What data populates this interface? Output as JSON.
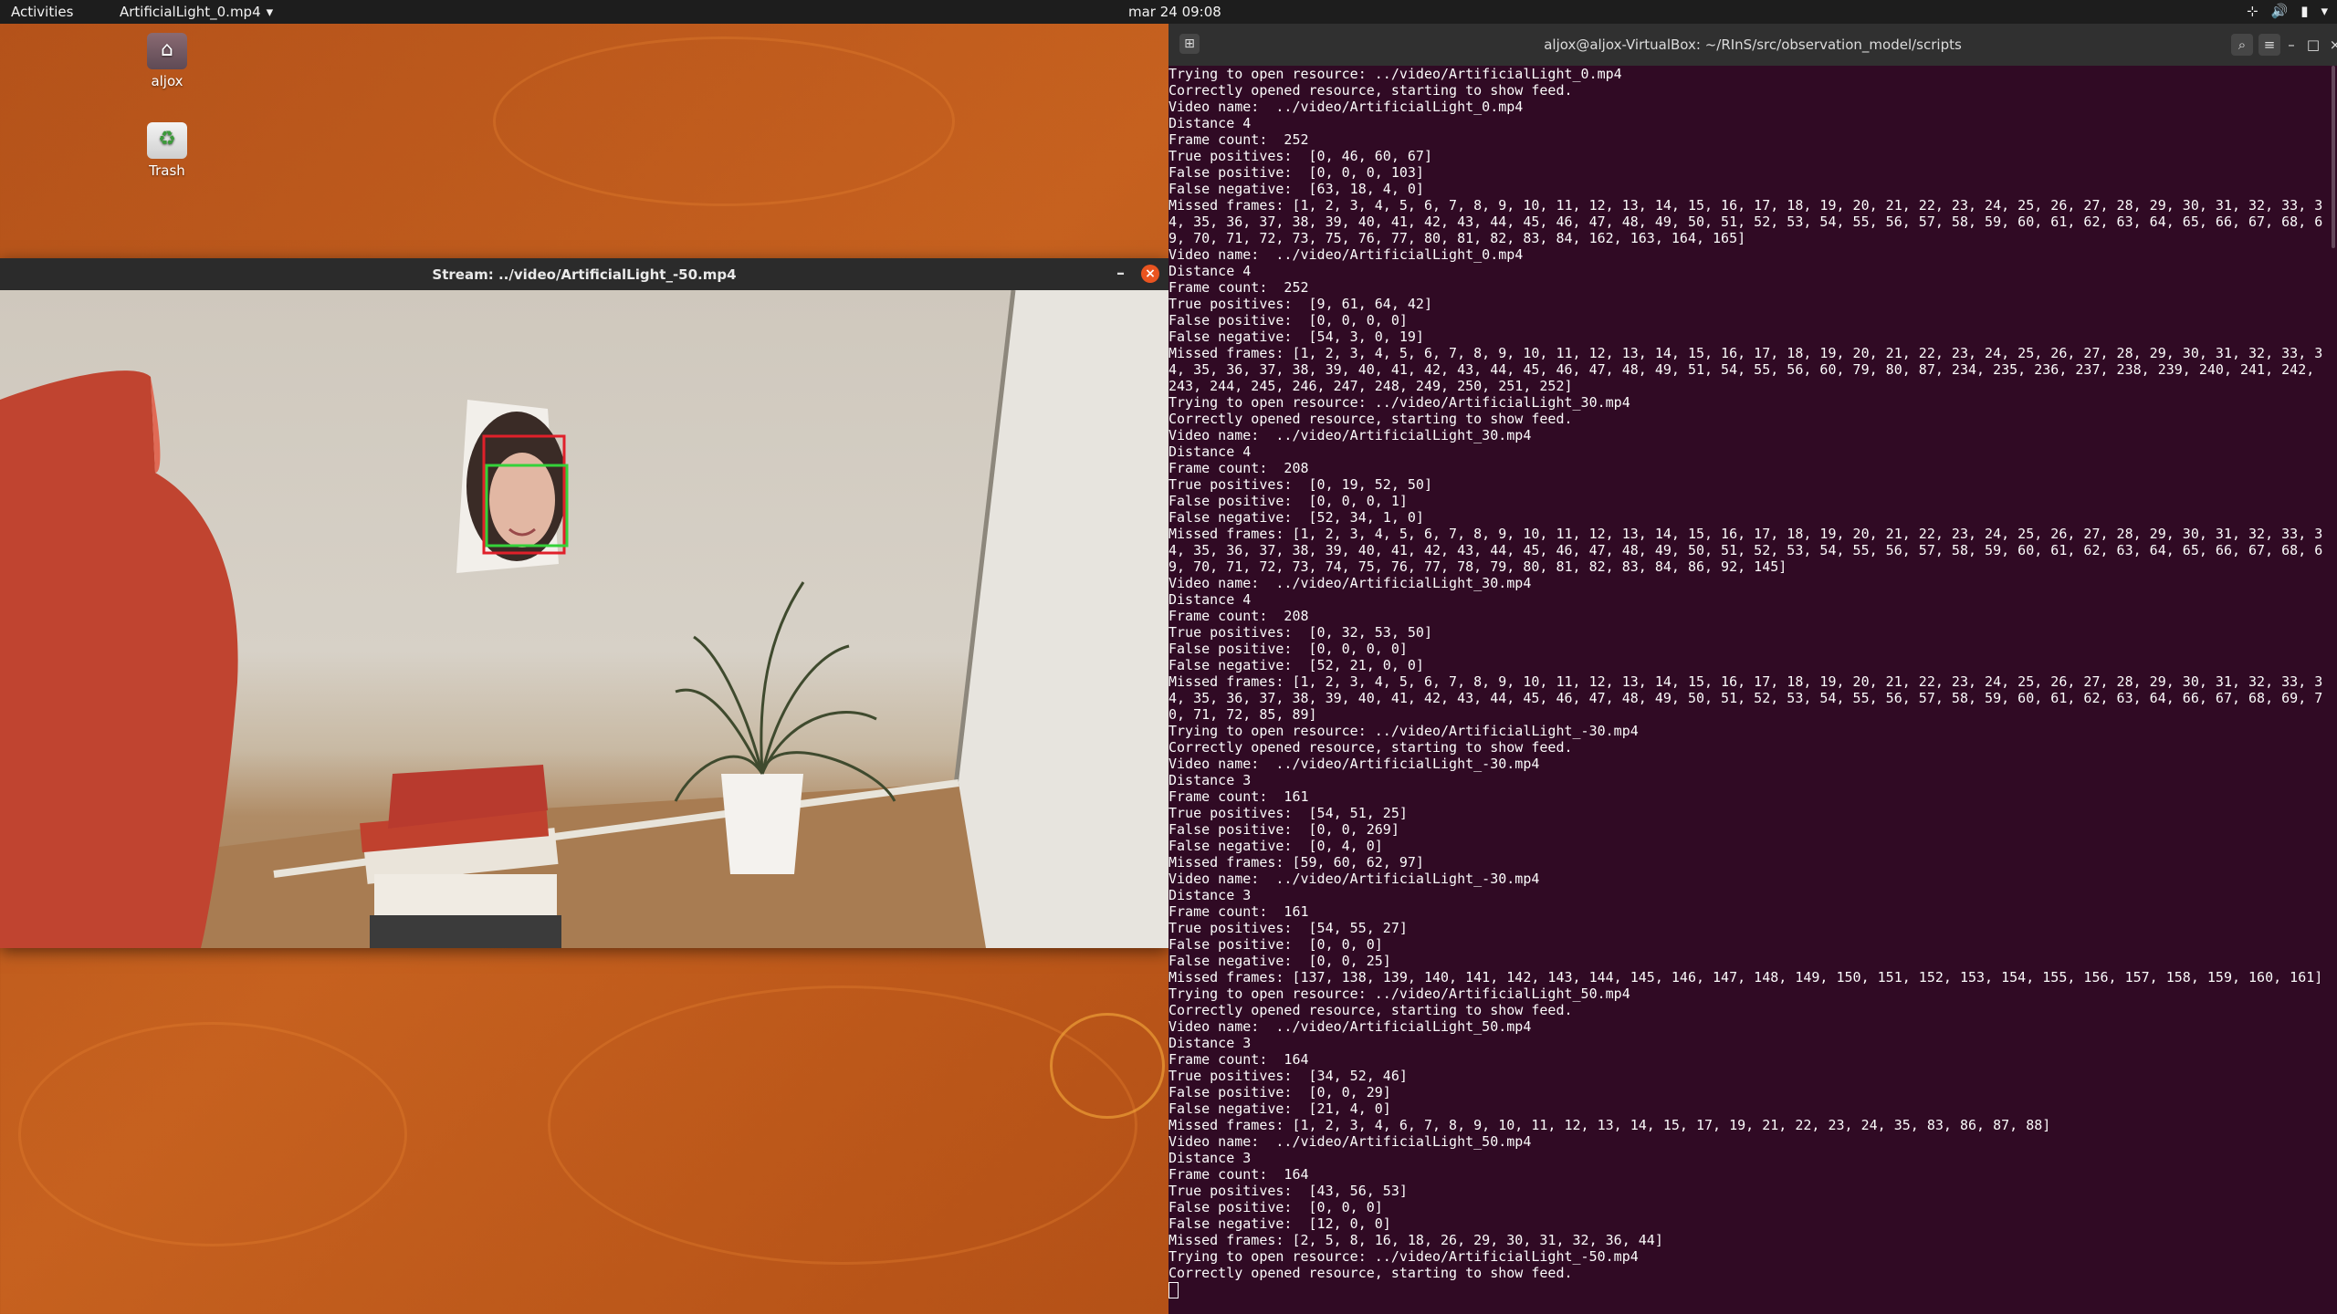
{
  "topbar": {
    "activities": "Activities",
    "app_name": "ArtificialLight_0.mp4",
    "clock": "mar 24  09:08",
    "tray": [
      "network-icon",
      "volume-icon",
      "battery-icon",
      "chevron-down-icon"
    ]
  },
  "desktop": {
    "icons": [
      {
        "label": "aljox",
        "icon": "home-folder-icon"
      },
      {
        "label": "Trash",
        "icon": "trash-icon"
      }
    ]
  },
  "stream_window": {
    "title": "Stream: ../video/ArtificialLight_-50.mp4",
    "minimize": "–",
    "close": "×"
  },
  "terminal": {
    "title": "aljox@aljox-VirtualBox: ~/RInS/src/observation_model/scripts",
    "lines": [
      "Trying to open resource: ../video/ArtificialLight_0.mp4",
      "Correctly opened resource, starting to show feed.",
      "Video name:  ../video/ArtificialLight_0.mp4",
      "Distance 4",
      "Frame count:  252",
      "True positives:  [0, 46, 60, 67]",
      "False positive:  [0, 0, 0, 103]",
      "False negative:  [63, 18, 4, 0]",
      "Missed frames: [1, 2, 3, 4, 5, 6, 7, 8, 9, 10, 11, 12, 13, 14, 15, 16, 17, 18, 19, 20, 21, 22, 23, 24, 25, 26, 27, 28, 29, 30, 31, 32, 33, 3",
      "4, 35, 36, 37, 38, 39, 40, 41, 42, 43, 44, 45, 46, 47, 48, 49, 50, 51, 52, 53, 54, 55, 56, 57, 58, 59, 60, 61, 62, 63, 64, 65, 66, 67, 68, 6",
      "9, 70, 71, 72, 73, 75, 76, 77, 80, 81, 82, 83, 84, 162, 163, 164, 165]",
      "Video name:  ../video/ArtificialLight_0.mp4",
      "Distance 4",
      "Frame count:  252",
      "True positives:  [9, 61, 64, 42]",
      "False positive:  [0, 0, 0, 0]",
      "False negative:  [54, 3, 0, 19]",
      "Missed frames: [1, 2, 3, 4, 5, 6, 7, 8, 9, 10, 11, 12, 13, 14, 15, 16, 17, 18, 19, 20, 21, 22, 23, 24, 25, 26, 27, 28, 29, 30, 31, 32, 33, 3",
      "4, 35, 36, 37, 38, 39, 40, 41, 42, 43, 44, 45, 46, 47, 48, 49, 51, 54, 55, 56, 60, 79, 80, 87, 234, 235, 236, 237, 238, 239, 240, 241, 242,",
      "243, 244, 245, 246, 247, 248, 249, 250, 251, 252]",
      "Trying to open resource: ../video/ArtificialLight_30.mp4",
      "Correctly opened resource, starting to show feed.",
      "Video name:  ../video/ArtificialLight_30.mp4",
      "Distance 4",
      "Frame count:  208",
      "True positives:  [0, 19, 52, 50]",
      "False positive:  [0, 0, 0, 1]",
      "False negative:  [52, 34, 1, 0]",
      "Missed frames: [1, 2, 3, 4, 5, 6, 7, 8, 9, 10, 11, 12, 13, 14, 15, 16, 17, 18, 19, 20, 21, 22, 23, 24, 25, 26, 27, 28, 29, 30, 31, 32, 33, 3",
      "4, 35, 36, 37, 38, 39, 40, 41, 42, 43, 44, 45, 46, 47, 48, 49, 50, 51, 52, 53, 54, 55, 56, 57, 58, 59, 60, 61, 62, 63, 64, 65, 66, 67, 68, 6",
      "9, 70, 71, 72, 73, 74, 75, 76, 77, 78, 79, 80, 81, 82, 83, 84, 86, 92, 145]",
      "Video name:  ../video/ArtificialLight_30.mp4",
      "Distance 4",
      "Frame count:  208",
      "True positives:  [0, 32, 53, 50]",
      "False positive:  [0, 0, 0, 0]",
      "False negative:  [52, 21, 0, 0]",
      "Missed frames: [1, 2, 3, 4, 5, 6, 7, 8, 9, 10, 11, 12, 13, 14, 15, 16, 17, 18, 19, 20, 21, 22, 23, 24, 25, 26, 27, 28, 29, 30, 31, 32, 33, 3",
      "4, 35, 36, 37, 38, 39, 40, 41, 42, 43, 44, 45, 46, 47, 48, 49, 50, 51, 52, 53, 54, 55, 56, 57, 58, 59, 60, 61, 62, 63, 64, 66, 67, 68, 69, 7",
      "0, 71, 72, 85, 89]",
      "Trying to open resource: ../video/ArtificialLight_-30.mp4",
      "Correctly opened resource, starting to show feed.",
      "Video name:  ../video/ArtificialLight_-30.mp4",
      "Distance 3",
      "Frame count:  161",
      "True positives:  [54, 51, 25]",
      "False positive:  [0, 0, 269]",
      "False negative:  [0, 4, 0]",
      "Missed frames: [59, 60, 62, 97]",
      "Video name:  ../video/ArtificialLight_-30.mp4",
      "Distance 3",
      "Frame count:  161",
      "True positives:  [54, 55, 27]",
      "False positive:  [0, 0, 0]",
      "False negative:  [0, 0, 25]",
      "Missed frames: [137, 138, 139, 140, 141, 142, 143, 144, 145, 146, 147, 148, 149, 150, 151, 152, 153, 154, 155, 156, 157, 158, 159, 160, 161]",
      "Trying to open resource: ../video/ArtificialLight_50.mp4",
      "Correctly opened resource, starting to show feed.",
      "Video name:  ../video/ArtificialLight_50.mp4",
      "Distance 3",
      "Frame count:  164",
      "True positives:  [34, 52, 46]",
      "False positive:  [0, 0, 29]",
      "False negative:  [21, 4, 0]",
      "Missed frames: [1, 2, 3, 4, 6, 7, 8, 9, 10, 11, 12, 13, 14, 15, 17, 19, 21, 22, 23, 24, 35, 83, 86, 87, 88]",
      "Video name:  ../video/ArtificialLight_50.mp4",
      "Distance 3",
      "Frame count:  164",
      "True positives:  [43, 56, 53]",
      "False positive:  [0, 0, 0]",
      "False negative:  [12, 0, 0]",
      "Missed frames: [2, 5, 8, 16, 18, 26, 29, 30, 31, 32, 36, 44]",
      "Trying to open resource: ../video/ArtificialLight_-50.mp4",
      "Correctly opened resource, starting to show feed."
    ]
  },
  "colors": {
    "desktop_orange": "#c05a1c",
    "terminal_bg": "#300a24",
    "close_button": "#e95420",
    "detection_red": "#e0202a",
    "detection_green": "#35d23a"
  }
}
